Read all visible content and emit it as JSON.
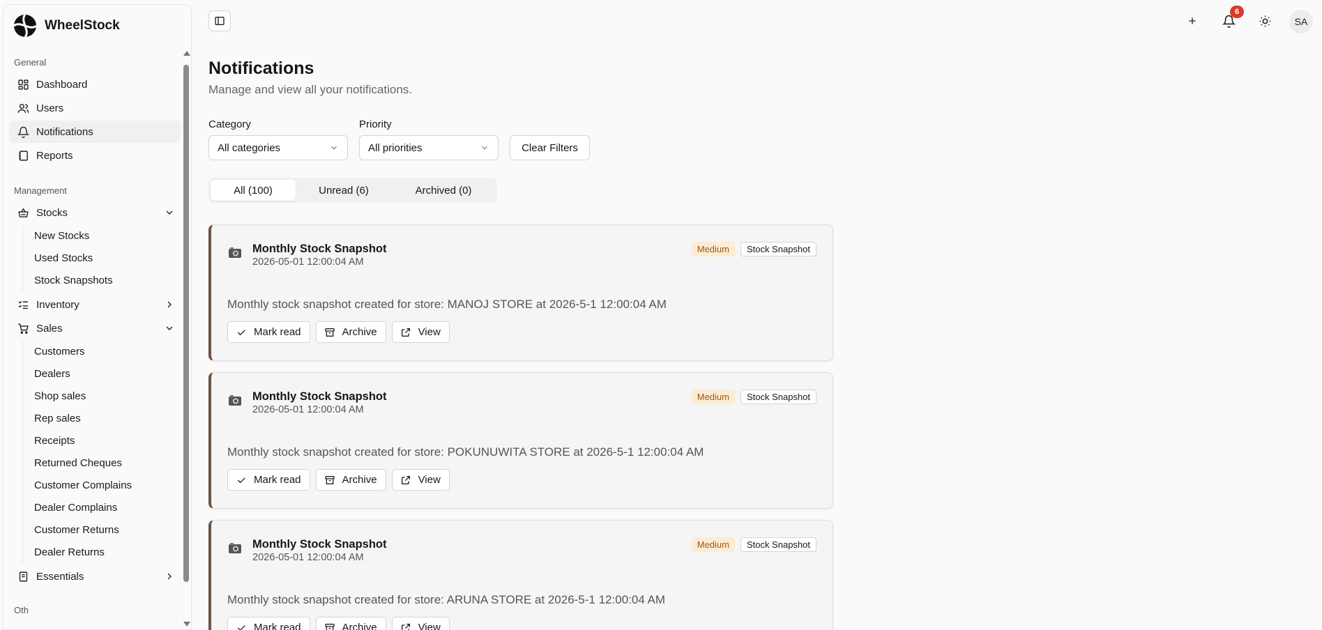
{
  "app": {
    "name": "WheelStock"
  },
  "sidebar": {
    "groups": [
      {
        "label": "General"
      },
      {
        "label": "Management"
      },
      {
        "label": "Oth"
      }
    ],
    "general": [
      {
        "label": "Dashboard",
        "icon": "dashboard-icon"
      },
      {
        "label": "Users",
        "icon": "users-icon"
      },
      {
        "label": "Notifications",
        "icon": "bell-icon",
        "active": true
      },
      {
        "label": "Reports",
        "icon": "notebook-icon"
      }
    ],
    "stocks": {
      "label": "Stocks",
      "icon": "basket-icon",
      "sub": [
        "New Stocks",
        "Used Stocks",
        "Stock Snapshots"
      ]
    },
    "inventory": {
      "label": "Inventory",
      "icon": "list-check-icon"
    },
    "sales": {
      "label": "Sales",
      "icon": "cart-icon",
      "sub": [
        "Customers",
        "Dealers",
        "Shop sales",
        "Rep sales",
        "Receipts",
        "Returned Cheques",
        "Customer Complains",
        "Dealer Complains",
        "Customer Returns",
        "Dealer Returns"
      ]
    },
    "essentials": {
      "label": "Essentials",
      "icon": "book-icon"
    }
  },
  "topbar": {
    "notification_count": "6",
    "avatar_initials": "SA"
  },
  "page": {
    "title": "Notifications",
    "subtitle": "Manage and view all your notifications."
  },
  "filters": {
    "category_label": "Category",
    "category_value": "All categories",
    "priority_label": "Priority",
    "priority_value": "All priorities",
    "clear_label": "Clear Filters"
  },
  "tabs": [
    {
      "label": "All (100)",
      "active": true
    },
    {
      "label": "Unread (6)"
    },
    {
      "label": "Archived (0)"
    }
  ],
  "actions": {
    "mark_read": "Mark read",
    "archive": "Archive",
    "view": "View"
  },
  "notifications": [
    {
      "emoji": "camera-icon",
      "title": "Monthly Stock Snapshot",
      "time": "2026-05-01 12:00:04 AM",
      "priority": "Medium",
      "category": "Stock Snapshot",
      "message": "Monthly stock snapshot created for store: MANOJ STORE at 2026-5-1 12:00:04 AM"
    },
    {
      "emoji": "camera-icon",
      "title": "Monthly Stock Snapshot",
      "time": "2026-05-01 12:00:04 AM",
      "priority": "Medium",
      "category": "Stock Snapshot",
      "message": "Monthly stock snapshot created for store: POKUNUWITA STORE at 2026-5-1 12:00:04 AM"
    },
    {
      "emoji": "camera-icon",
      "title": "Monthly Stock Snapshot",
      "time": "2026-05-01 12:00:04 AM",
      "priority": "Medium",
      "category": "Stock Snapshot",
      "message": "Monthly stock snapshot created for store: ARUNA STORE at 2026-5-1 12:00:04 AM"
    }
  ],
  "colors": {
    "accent_border": "#6b5346",
    "badge_red": "#dc3a2a",
    "priority_bg": "#fbecd2",
    "priority_text": "#9a5a1a"
  }
}
